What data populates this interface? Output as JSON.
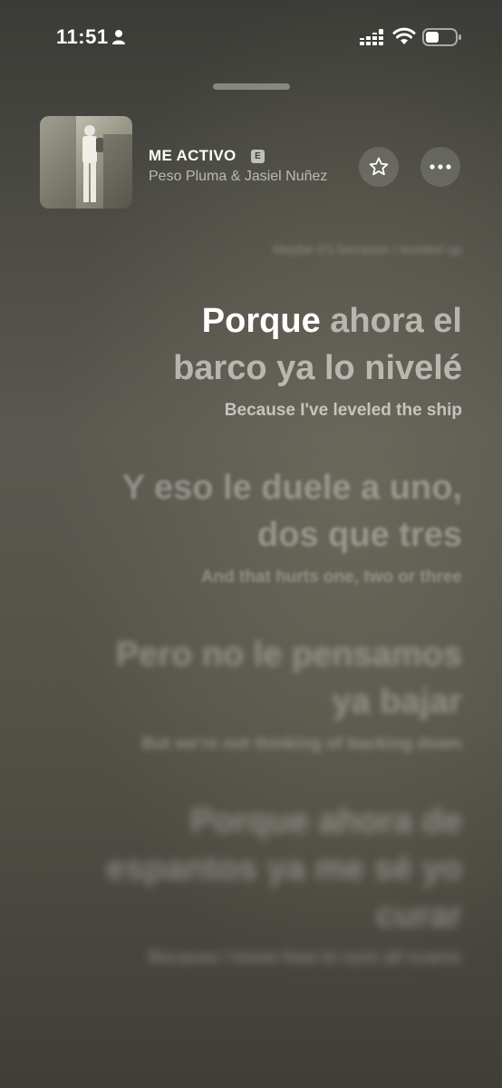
{
  "status_bar": {
    "time": "11:51",
    "icons": [
      "person-icon",
      "cellular-signal-icon",
      "wifi-icon",
      "battery-icon"
    ]
  },
  "now_playing": {
    "title": "ME ACTIVO",
    "explicit_badge": "E",
    "artist": "Peso Pluma & Jasiel Nuñez",
    "favorite_icon": "star-icon",
    "more_icon": "ellipsis-icon"
  },
  "lyrics": {
    "previous_translation": "Maybe it's because I leveled up",
    "current": {
      "sung": "Porque",
      "rest": " ahora el barco ya lo nivelé",
      "translation": "Because I've leveled the ship"
    },
    "upcoming": [
      {
        "line": "Y eso le duele a uno, dos que tres",
        "translation": "And that hurts one, two or three"
      },
      {
        "line": "Pero no le pensamos ya bajar",
        "translation": "But we're not thinking of backing down"
      },
      {
        "line": "Porque ahora de espantos ya me sé yo curar",
        "translation": "Because I know how to cure all scares"
      }
    ]
  },
  "colors": {
    "background_top": "#3a3b36",
    "background_mid": "#5a5850",
    "highlight_text": "#ffffff"
  }
}
